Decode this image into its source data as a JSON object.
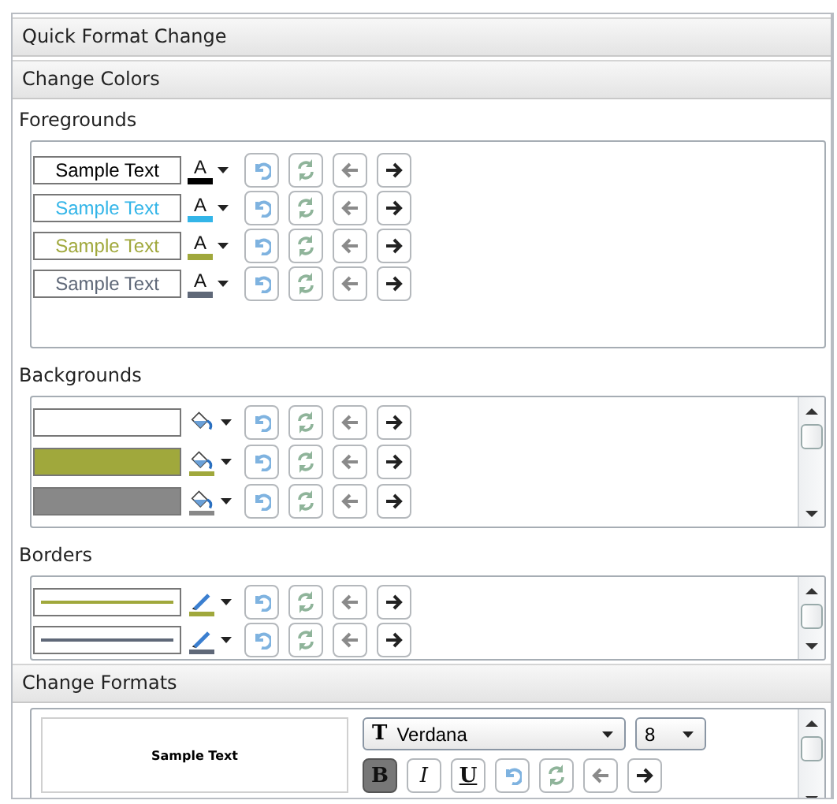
{
  "title": "Quick Format Change",
  "colors_section": {
    "title": "Change Colors",
    "foregrounds": {
      "label": "Foregrounds",
      "rows": [
        {
          "sample": "Sample Text",
          "color": "#000000",
          "icon_text": "A",
          "back_enabled": false,
          "forward_enabled": true
        },
        {
          "sample": "Sample Text",
          "color": "#33b5e8",
          "icon_text": "A",
          "back_enabled": false,
          "forward_enabled": true
        },
        {
          "sample": "Sample Text",
          "color": "#a0a83c",
          "icon_text": "A",
          "back_enabled": false,
          "forward_enabled": true
        },
        {
          "sample": "Sample Text",
          "color": "#5f6878",
          "icon_text": "A",
          "back_enabled": false,
          "forward_enabled": true
        }
      ]
    },
    "backgrounds": {
      "label": "Backgrounds",
      "rows": [
        {
          "color": "#ffffff",
          "back_enabled": false,
          "forward_enabled": true
        },
        {
          "color": "#a0a83c",
          "back_enabled": false,
          "forward_enabled": true
        },
        {
          "color": "#888888",
          "back_enabled": false,
          "forward_enabled": true
        }
      ]
    },
    "borders": {
      "label": "Borders",
      "rows": [
        {
          "color": "#a0a83c",
          "back_enabled": false,
          "forward_enabled": true
        },
        {
          "color": "#5f6878",
          "back_enabled": false,
          "forward_enabled": true
        }
      ]
    }
  },
  "formats_section": {
    "title": "Change Formats",
    "preview": "Sample Text",
    "font_icon": "T",
    "font": "Verdana",
    "size": "8",
    "styles": [
      {
        "label": "B",
        "kind": "bold",
        "selected": true
      },
      {
        "label": "I",
        "kind": "italic",
        "selected": false
      },
      {
        "label": "U",
        "kind": "underline",
        "selected": false
      }
    ],
    "back_enabled": false,
    "forward_enabled": true
  }
}
